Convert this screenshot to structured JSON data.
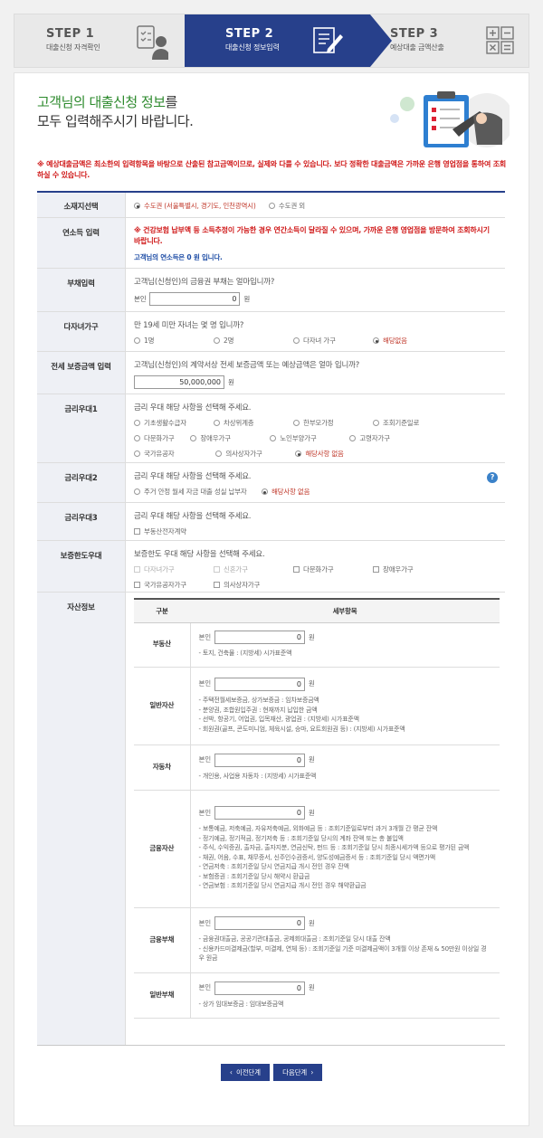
{
  "steps": [
    {
      "num": "STEP 1",
      "label": "대출신청 자격확인"
    },
    {
      "num": "STEP 2",
      "label": "대출신청 정보입력"
    },
    {
      "num": "STEP 3",
      "label": "예상대출 금액산출"
    }
  ],
  "heading": {
    "line1_green": "고객님의 대출신청 정보",
    "line1_rest": "를",
    "line2": "모두 입력해주시기 바랍니다."
  },
  "notice": "※ 예상대출금액은 최소한의 입력항목을 바탕으로 산출된 참고금액이므로, 실제와 다를 수 있습니다. 보다 정확한 대출금액은 가까운 은행 영업점을 통하여 조회하실 수 있습니다.",
  "location": {
    "label": "소재지선택",
    "opt1": "수도권 (서울특별시, 경기도, 인천광역시)",
    "opt2": "수도권 외",
    "selected": "opt1"
  },
  "income": {
    "label": "연소득 입력",
    "warn": "※ 건강보험 납부액 등 소득추정이 가능한 경우 연간소득이 달라질 수 있으며, 가까운 은행 영업점을 방문하여 조회하시기 바랍니다.",
    "info": "고객님의 연소득은 0 원 입니다."
  },
  "debt": {
    "label": "부채입력",
    "question": "고객님(신청인)의 금융권 부채는 얼마입니까?",
    "prefix": "본인",
    "value": "0",
    "unit": "원"
  },
  "kids": {
    "label": "다자녀가구",
    "question": "만 19세 미만 자녀는 몇 명 입니까?",
    "options": [
      "1명",
      "2명",
      "다자녀 가구",
      "해당없음"
    ],
    "selected": "해당없음"
  },
  "deposit": {
    "label": "전세 보증금액 입력",
    "question": "고객님(신청인)의 계약서상 전세 보증금액 또는 예상금액은 얼마 입니까?",
    "value": "50,000,000",
    "unit": "원"
  },
  "pref1": {
    "label": "금리우대1",
    "question": "금리 우대 해당 사항을 선택해 주세요.",
    "options": [
      "기초생활수급자",
      "차상위계층",
      "한부모가정",
      "조회기준일로",
      "다문화가구",
      "장애우가구",
      "노인부양가구",
      "고령자가구",
      "국가유공자",
      "의사상자가구",
      "해당사항 없음"
    ],
    "selected": "해당사항 없음"
  },
  "pref2": {
    "label": "금리우대2",
    "question": "금리 우대 해당 사항을 선택해 주세요.",
    "options": [
      "주거 안정 월세 자금 대출 성실 납부자",
      "해당사항 없음"
    ],
    "selected": "해당사항 없음",
    "help": "?"
  },
  "pref3": {
    "label": "금리우대3",
    "question": "금리 우대 해당 사항을 선택해 주세요.",
    "options": [
      "부동산전자계약"
    ]
  },
  "guarantee": {
    "label": "보증한도우대",
    "question": "보증한도 우대 해당 사항을 선택해 주세요.",
    "options": [
      "다자녀가구",
      "신혼가구",
      "다문화가구",
      "장애우가구",
      "국가유공자가구",
      "의사상자가구"
    ]
  },
  "assets": {
    "label": "자산정보",
    "col1": "구분",
    "col2": "세부항목",
    "prefix": "본인",
    "unit": "원",
    "rows": [
      {
        "cat": "부동산",
        "value": "0",
        "notes": [
          "- 토지, 건축물 : (지방세) 시가표준액"
        ]
      },
      {
        "cat": "일반자산",
        "value": "0",
        "notes": [
          "- 주택전월세보증금, 상가보증금 : 임차보증금액",
          "- 분양권, 조합원입주권 : 현재까지 납입한 금액",
          "- 선박, 항공기, 어업권, 입목재산, 광업권 : (지방세) 시가표준액",
          "- 회원권(골프, 콘도미니엄, 체육시설, 승마, 요트회원권 등) : (지방세) 시가표준액"
        ]
      },
      {
        "cat": "자동차",
        "value": "0",
        "notes": [
          "- 개인용, 사업용 자동차 : (지방세) 시가표준액"
        ]
      },
      {
        "cat": "금융자산",
        "value": "0",
        "notes": [
          "- 보통예금, 저축예금, 자유저축예금, 외화예금 등 : 조회기준일로부터 과거 3개월 간 평균 잔액",
          "- 정기예금, 정기적금, 정기저축 등 : 조회기준일 당시의 계좌 잔액 또는 총 불입액",
          "- 주식, 수익증권, 출자금, 출자지분, 연금신탁, 펀드 등 : 조회기준일 당시 최종시세가액 등으로 평가된 금액",
          "- 채권, 어음, 수표, 채무증서, 신주인수권증서, 양도성예금증서 등 : 조회기준일 당시 액면가액",
          "- 연금저축 : 조회기준일 당시 연금지급 개시 전인 경우 잔액",
          "- 보험증권 : 조회기준일 당시 해약시 환급금",
          "- 연금보험 : 조회기준일 당시 연금지급 개시 전인 경우 해약환급금"
        ]
      },
      {
        "cat": "금융부채",
        "value": "0",
        "notes": [
          "- 금융권대출금, 공공기관대출금, 공제회대출금 : 조회기준일 당시 대출 잔액",
          "- 신용카드미결제금(할부, 미결제, 연체 등) : 조회기준일 기준 미결제금액이 3개월 이상 존재 & 50만원 이상일 경우 원금"
        ]
      },
      {
        "cat": "일반부채",
        "value": "0",
        "notes": [
          "- 상가 임대보증금 : 임대보증금액"
        ]
      }
    ]
  },
  "buttons": {
    "prev": "이전단계",
    "next": "다음단계"
  }
}
